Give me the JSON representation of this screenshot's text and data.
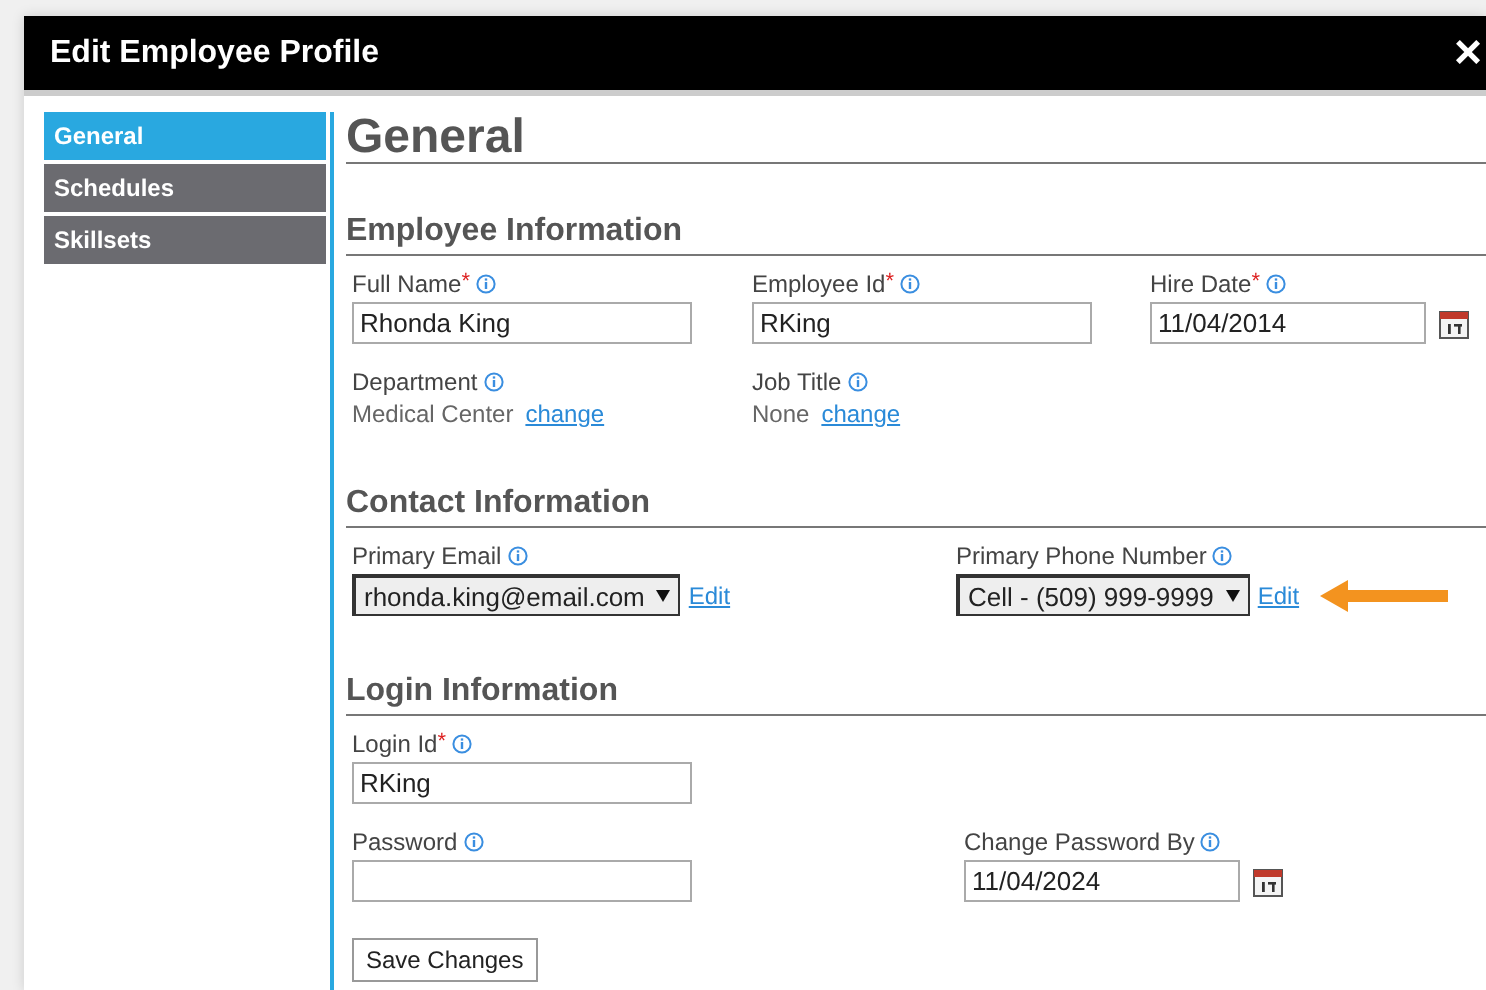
{
  "window": {
    "title": "Edit Employee Profile",
    "close": "×"
  },
  "sidebar": {
    "items": [
      {
        "label": "General",
        "selected": true
      },
      {
        "label": "Schedules",
        "selected": false
      },
      {
        "label": "Skillsets",
        "selected": false
      }
    ]
  },
  "page_title": "General",
  "sections": [
    {
      "title": "Employee Information",
      "rows": [
        [
          {
            "kind": "text",
            "label": "Full Name",
            "required_mark": "*",
            "value": "Rhonda King"
          },
          {
            "kind": "text",
            "label": "Employee Id",
            "required_mark": "*",
            "value": "RKing"
          },
          {
            "kind": "date",
            "label": "Hire Date",
            "required_mark": "*",
            "value": "11/04/2014"
          }
        ],
        [
          {
            "kind": "static",
            "label": "Department",
            "value": "Medical Center",
            "link": "change"
          },
          {
            "kind": "static",
            "label": "Job Title",
            "value": "None",
            "link": "change"
          }
        ]
      ]
    },
    {
      "title": "Contact Information",
      "rows": [
        [
          {
            "kind": "select",
            "label": "Primary Email",
            "value": "rhonda.king@email.com",
            "link": "Edit",
            "highlighted": false
          },
          {
            "kind": "select",
            "label": "Primary Phone Number",
            "value": "Cell - (509) 999-9999",
            "link": "Edit",
            "highlighted": true
          }
        ]
      ]
    },
    {
      "title": "Login Information",
      "rows": [
        [
          {
            "kind": "text",
            "label": "Login Id",
            "required_mark": "*",
            "value": "RKing"
          }
        ],
        [
          {
            "kind": "password",
            "label": "Password"
          },
          {
            "kind": "date",
            "label": "Change Password By",
            "value": "11/04/2024"
          }
        ]
      ]
    }
  ],
  "save_button": "Save Changes"
}
